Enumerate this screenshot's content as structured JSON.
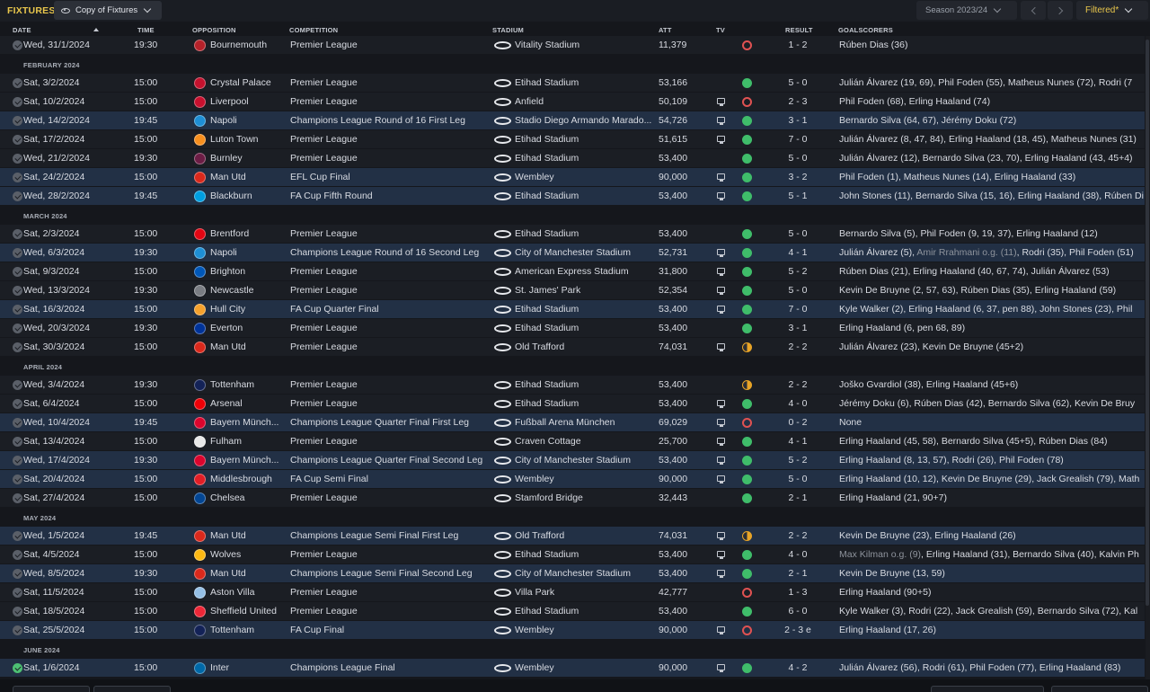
{
  "topbar": {
    "title": "FIXTURES",
    "view_label": "Copy of Fixtures",
    "season_label": "Season 2023/24",
    "filter_label": "Filtered*"
  },
  "columns": {
    "date": "DATE",
    "time": "TIME",
    "opposition": "OPPOSITION",
    "competition": "COMPETITION",
    "stadium": "STADIUM",
    "att": "ATT",
    "tv": "TV",
    "result": "RESULT",
    "goalscorers": "GOALSCORERS"
  },
  "colors": {
    "accent": "#e8c64c",
    "row": "#1b1e24",
    "row_highlight": "#223045",
    "win": "#3fbd6a",
    "loss": "#e05252",
    "draw": "#e8a427"
  },
  "rows": [
    {
      "type": "fixture",
      "date": "Wed, 31/1/2024",
      "time": "19:30",
      "opp": "Bournemouth",
      "crest": "#b5222a",
      "comp": "Premier League",
      "stadium": "Vitality Stadium",
      "att": "11,379",
      "tv": false,
      "res": "l",
      "result": "1 - 2",
      "scorers": [
        "Rúben Dias (36)"
      ]
    },
    {
      "type": "month",
      "label": "FEBRUARY 2024"
    },
    {
      "type": "fixture",
      "date": "Sat, 3/2/2024",
      "time": "15:00",
      "opp": "Crystal Palace",
      "crest": "#c4122e",
      "comp": "Premier League",
      "stadium": "Etihad Stadium",
      "att": "53,166",
      "tv": false,
      "res": "w",
      "result": "5 - 0",
      "scorers": [
        "Julián Álvarez (19, 69), Phil Foden (55), Matheus Nunes (72), Rodri (7"
      ]
    },
    {
      "type": "fixture",
      "date": "Sat, 10/2/2024",
      "time": "15:00",
      "opp": "Liverpool",
      "crest": "#c8102e",
      "comp": "Premier League",
      "stadium": "Anfield",
      "att": "50,109",
      "tv": true,
      "res": "l",
      "result": "2 - 3",
      "scorers": [
        "Phil Foden (68), Erling Haaland (74)"
      ]
    },
    {
      "type": "fixture",
      "hl": true,
      "date": "Wed, 14/2/2024",
      "time": "19:45",
      "opp": "Napoli",
      "crest": "#1e8fd5",
      "comp": "Champions League Round of 16  First Leg",
      "stadium": "Stadio Diego Armando Marado...",
      "att": "54,726",
      "tv": true,
      "res": "w",
      "result": "3 - 1",
      "scorers": [
        "Bernardo Silva (64, 67), Jérémy Doku (72)"
      ]
    },
    {
      "type": "fixture",
      "date": "Sat, 17/2/2024",
      "time": "15:00",
      "opp": "Luton Town",
      "crest": "#f78f1e",
      "comp": "Premier League",
      "stadium": "Etihad Stadium",
      "att": "51,615",
      "tv": true,
      "res": "w",
      "result": "7 - 0",
      "scorers": [
        "Julián Álvarez (8, 47, 84), Erling Haaland (18, 45), Matheus Nunes (31)"
      ]
    },
    {
      "type": "fixture",
      "date": "Wed, 21/2/2024",
      "time": "19:30",
      "opp": "Burnley",
      "crest": "#6c1d45",
      "comp": "Premier League",
      "stadium": "Etihad Stadium",
      "att": "53,400",
      "tv": false,
      "res": "w",
      "result": "5 - 0",
      "scorers": [
        "Julián Álvarez (12), Bernardo Silva (23, 70), Erling Haaland (43, 45+4)"
      ]
    },
    {
      "type": "fixture",
      "hl": true,
      "date": "Sat, 24/2/2024",
      "time": "15:00",
      "opp": "Man Utd",
      "crest": "#da291c",
      "comp": "EFL Cup Final",
      "stadium": "Wembley",
      "att": "90,000",
      "tv": true,
      "res": "w",
      "result": "3 - 2",
      "scorers": [
        "Phil Foden (1), Matheus Nunes (14), Erling Haaland (33)"
      ]
    },
    {
      "type": "fixture",
      "hl": true,
      "date": "Wed, 28/2/2024",
      "time": "19:45",
      "opp": "Blackburn",
      "crest": "#009ee0",
      "comp": "FA Cup Fifth Round",
      "stadium": "Etihad Stadium",
      "att": "53,400",
      "tv": true,
      "res": "w",
      "result": "5 - 1",
      "scorers": [
        "John Stones (11), Bernardo Silva (15, 16), Erling Haaland (38), Rúben Di"
      ]
    },
    {
      "type": "month",
      "label": "MARCH 2024"
    },
    {
      "type": "fixture",
      "date": "Sat, 2/3/2024",
      "time": "15:00",
      "opp": "Brentford",
      "crest": "#e30613",
      "comp": "Premier League",
      "stadium": "Etihad Stadium",
      "att": "53,400",
      "tv": false,
      "res": "w",
      "result": "5 - 0",
      "scorers": [
        "Bernardo Silva (5), Phil Foden (9, 19, 37), Erling Haaland (12)"
      ]
    },
    {
      "type": "fixture",
      "hl": true,
      "date": "Wed, 6/3/2024",
      "time": "19:30",
      "opp": "Napoli",
      "crest": "#1e8fd5",
      "comp": "Champions League Round of 16  Second Leg",
      "stadium": "City of Manchester Stadium",
      "att": "52,731",
      "tv": true,
      "res": "w",
      "result": "4 - 1",
      "scorers": [
        "Julián Álvarez (5), ",
        {
          "og": "Amir Rrahmani o.g. (11)"
        },
        ", Rodri (35), Phil Foden (51)"
      ]
    },
    {
      "type": "fixture",
      "date": "Sat, 9/3/2024",
      "time": "15:00",
      "opp": "Brighton",
      "crest": "#0057b8",
      "comp": "Premier League",
      "stadium": "American Express Stadium",
      "att": "31,800",
      "tv": true,
      "res": "w",
      "result": "5 - 2",
      "scorers": [
        "Rúben Dias (21), Erling Haaland (40, 67, 74), Julián Álvarez (53)"
      ]
    },
    {
      "type": "fixture",
      "date": "Wed, 13/3/2024",
      "time": "19:30",
      "opp": "Newcastle",
      "crest": "#7a7d83",
      "comp": "Premier League",
      "stadium": "St. James' Park",
      "att": "52,354",
      "tv": true,
      "res": "w",
      "result": "5 - 0",
      "scorers": [
        "Kevin De Bruyne (2, 57, 63), Rúben Dias (35), Erling Haaland (59)"
      ]
    },
    {
      "type": "fixture",
      "hl": true,
      "date": "Sat, 16/3/2024",
      "time": "15:00",
      "opp": "Hull City",
      "crest": "#f5a12d",
      "comp": "FA Cup Quarter Final",
      "stadium": "Etihad Stadium",
      "att": "53,400",
      "tv": true,
      "res": "w",
      "result": "7 - 0",
      "scorers": [
        "Kyle Walker (2), Erling Haaland (6, 37, pen 88), John Stones (23), Phil"
      ]
    },
    {
      "type": "fixture",
      "date": "Wed, 20/3/2024",
      "time": "19:30",
      "opp": "Everton",
      "crest": "#003399",
      "comp": "Premier League",
      "stadium": "Etihad Stadium",
      "att": "53,400",
      "tv": false,
      "res": "w",
      "result": "3 - 1",
      "scorers": [
        "Erling Haaland (6, pen 68, 89)"
      ]
    },
    {
      "type": "fixture",
      "date": "Sat, 30/3/2024",
      "time": "15:00",
      "opp": "Man Utd",
      "crest": "#da291c",
      "comp": "Premier League",
      "stadium": "Old Trafford",
      "att": "74,031",
      "tv": true,
      "res": "d",
      "result": "2 - 2",
      "scorers": [
        "Julián Álvarez (23), Kevin De Bruyne (45+2)"
      ]
    },
    {
      "type": "month",
      "label": "APRIL 2024"
    },
    {
      "type": "fixture",
      "date": "Wed, 3/4/2024",
      "time": "19:30",
      "opp": "Tottenham",
      "crest": "#132257",
      "comp": "Premier League",
      "stadium": "Etihad Stadium",
      "att": "53,400",
      "tv": false,
      "res": "d",
      "result": "2 - 2",
      "scorers": [
        "Joško Gvardiol (38), Erling Haaland (45+6)"
      ]
    },
    {
      "type": "fixture",
      "date": "Sat, 6/4/2024",
      "time": "15:00",
      "opp": "Arsenal",
      "crest": "#ef0107",
      "comp": "Premier League",
      "stadium": "Etihad Stadium",
      "att": "53,400",
      "tv": true,
      "res": "w",
      "result": "4 - 0",
      "scorers": [
        "Jérémy Doku (6), Rúben Dias (42), Bernardo Silva (62), Kevin De Bruy"
      ]
    },
    {
      "type": "fixture",
      "hl": true,
      "date": "Wed, 10/4/2024",
      "time": "19:45",
      "opp": "Bayern Münch...",
      "crest": "#dc052d",
      "comp": "Champions League Quarter Final First Leg",
      "stadium": "Fußball Arena München",
      "att": "69,029",
      "tv": true,
      "res": "l",
      "result": "0 - 2",
      "scorers": [
        "None"
      ]
    },
    {
      "type": "fixture",
      "date": "Sat, 13/4/2024",
      "time": "15:00",
      "opp": "Fulham",
      "crest": "#e8e8e8",
      "comp": "Premier League",
      "stadium": "Craven Cottage",
      "att": "25,700",
      "tv": true,
      "res": "w",
      "result": "4 - 1",
      "scorers": [
        "Erling Haaland (45, 58), Bernardo Silva (45+5), Rúben Dias (84)"
      ]
    },
    {
      "type": "fixture",
      "hl": true,
      "date": "Wed, 17/4/2024",
      "time": "19:30",
      "opp": "Bayern Münch...",
      "crest": "#dc052d",
      "comp": "Champions League Quarter Final Second Leg",
      "stadium": "City of Manchester Stadium",
      "att": "53,400",
      "tv": true,
      "res": "w",
      "result": "5 - 2",
      "scorers": [
        "Erling Haaland (8, 13, 57), Rodri (26), Phil Foden (78)"
      ]
    },
    {
      "type": "fixture",
      "hl": true,
      "date": "Sat, 20/4/2024",
      "time": "15:00",
      "opp": "Middlesbrough",
      "crest": "#e21e26",
      "comp": "FA Cup Semi Final",
      "stadium": "Wembley",
      "att": "90,000",
      "tv": true,
      "res": "w",
      "result": "5 - 0",
      "scorers": [
        "Erling Haaland (10, 12), Kevin De Bruyne (29), Jack Grealish (79), Math"
      ]
    },
    {
      "type": "fixture",
      "date": "Sat, 27/4/2024",
      "time": "15:00",
      "opp": "Chelsea",
      "crest": "#034694",
      "comp": "Premier League",
      "stadium": "Stamford Bridge",
      "att": "32,443",
      "tv": false,
      "res": "w",
      "result": "2 - 1",
      "scorers": [
        "Erling Haaland (21, 90+7)"
      ]
    },
    {
      "type": "month",
      "label": "MAY 2024"
    },
    {
      "type": "fixture",
      "hl": true,
      "date": "Wed, 1/5/2024",
      "time": "19:45",
      "opp": "Man Utd",
      "crest": "#da291c",
      "comp": "Champions League Semi Final First Leg",
      "stadium": "Old Trafford",
      "att": "74,031",
      "tv": true,
      "res": "d",
      "result": "2 - 2",
      "scorers": [
        "Kevin De Bruyne (23), Erling Haaland (26)"
      ]
    },
    {
      "type": "fixture",
      "date": "Sat, 4/5/2024",
      "time": "15:00",
      "opp": "Wolves",
      "crest": "#fdb913",
      "comp": "Premier League",
      "stadium": "Etihad Stadium",
      "att": "53,400",
      "tv": true,
      "res": "w",
      "result": "4 - 0",
      "scorers": [
        {
          "og": "Max Kilman o.g. (9)"
        },
        ", Erling Haaland (31), Bernardo Silva (40), Kalvin Ph"
      ]
    },
    {
      "type": "fixture",
      "hl": true,
      "date": "Wed, 8/5/2024",
      "time": "19:30",
      "opp": "Man Utd",
      "crest": "#da291c",
      "comp": "Champions League Semi Final Second Leg",
      "stadium": "City of Manchester Stadium",
      "att": "53,400",
      "tv": true,
      "res": "w",
      "result": "2 - 1",
      "scorers": [
        "Kevin De Bruyne (13, 59)"
      ]
    },
    {
      "type": "fixture",
      "date": "Sat, 11/5/2024",
      "time": "15:00",
      "opp": "Aston Villa",
      "crest": "#95bfe5",
      "comp": "Premier League",
      "stadium": "Villa Park",
      "att": "42,777",
      "tv": false,
      "res": "l",
      "result": "1 - 3",
      "scorers": [
        "Erling Haaland (90+5)"
      ]
    },
    {
      "type": "fixture",
      "date": "Sat, 18/5/2024",
      "time": "15:00",
      "opp": "Sheffield United",
      "crest": "#ee2737",
      "comp": "Premier League",
      "stadium": "Etihad Stadium",
      "att": "53,400",
      "tv": false,
      "res": "w",
      "result": "6 - 0",
      "scorers": [
        "Kyle Walker (3), Rodri (22), Jack Grealish (59), Bernardo Silva (72), Kal"
      ]
    },
    {
      "type": "fixture",
      "hl": true,
      "date": "Sat, 25/5/2024",
      "time": "15:00",
      "opp": "Tottenham",
      "crest": "#132257",
      "comp": "FA Cup Final",
      "stadium": "Wembley",
      "att": "90,000",
      "tv": true,
      "res": "l",
      "result": "2 - 3 e",
      "scorers": [
        "Erling Haaland (17, 26)"
      ]
    },
    {
      "type": "month",
      "label": "JUNE 2024"
    },
    {
      "type": "fixture",
      "hl": true,
      "green_check": true,
      "date": "Sat, 1/6/2024",
      "time": "15:00",
      "opp": "Inter",
      "crest": "#0068a8",
      "comp": "Champions League Final",
      "stadium": "Wembley",
      "att": "90,000",
      "tv": true,
      "res": "w",
      "result": "4 - 2",
      "scorers": [
        "Julián Álvarez (56), Rodri (61), Phil Foden (77), Erling Haaland (83)"
      ]
    }
  ]
}
